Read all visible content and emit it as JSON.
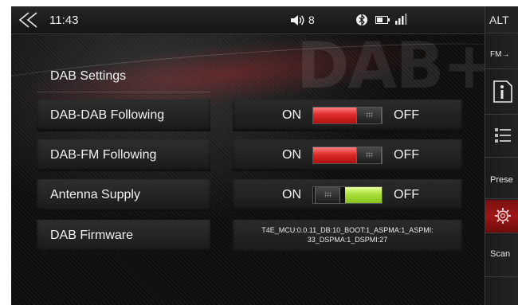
{
  "status_bar": {
    "time": "11:43",
    "volume_level": "8",
    "icons": [
      "back-icon",
      "volume-icon",
      "bluetooth-icon",
      "battery-icon",
      "signal-icon"
    ]
  },
  "watermark": "DAB+",
  "sidebar": {
    "alt_label": "ALT",
    "fm_label": "FM→",
    "preset_label": "Prese",
    "scan_label": "Scan",
    "icons": [
      "info-icon",
      "list-icon",
      "settings-icon"
    ],
    "active_color": "#a01616"
  },
  "settings": {
    "header": "DAB Settings",
    "rows": [
      {
        "label": "DAB-DAB Following",
        "on_label": "ON",
        "off_label": "OFF",
        "state": "on",
        "indicator_color": "#e02a2a"
      },
      {
        "label": "DAB-FM Following",
        "on_label": "ON",
        "off_label": "OFF",
        "state": "on",
        "indicator_color": "#e02a2a"
      },
      {
        "label": "Antenna Supply",
        "on_label": "ON",
        "off_label": "OFF",
        "state": "off",
        "indicator_color": "#a8e03a"
      }
    ],
    "firmware": {
      "label": "DAB Firmware",
      "line1": "T4E_MCU:0.0.11_DB:10_BOOT:1_ASPMA:1_ASPMI:",
      "line2": "33_DSPMA:1_DSPMI:27"
    }
  }
}
